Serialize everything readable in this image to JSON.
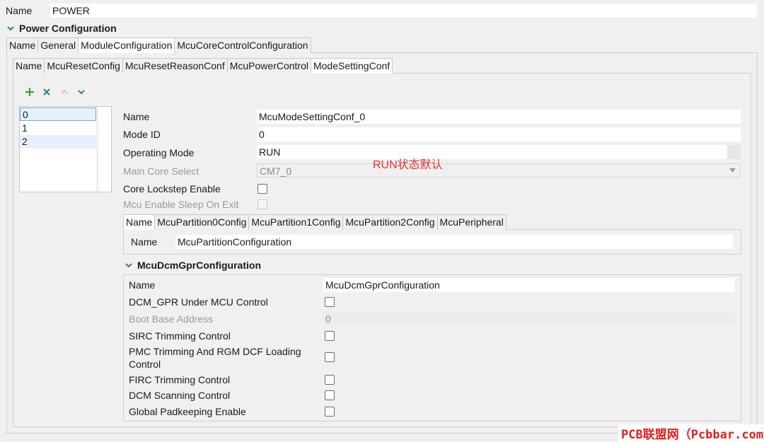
{
  "top": {
    "name_label": "Name",
    "name_value": "POWER"
  },
  "power_section": {
    "title": "Power Configuration"
  },
  "outer_tabs": [
    "Name",
    "General",
    "ModuleConfiguration",
    "McuCoreControlConfiguration"
  ],
  "inner_tabs": [
    "Name",
    "McuResetConfig",
    "McuResetReasonConf",
    "McuPowerControl",
    "ModeSettingConf"
  ],
  "list": {
    "items": [
      "0",
      "1",
      "2"
    ]
  },
  "form": {
    "name_label": "Name",
    "name_value": "McuModeSettingConf_0",
    "modeid_label": "Mode ID",
    "modeid_value": "0",
    "opmode_label": "Operating Mode",
    "opmode_value": "RUN",
    "maincore_label": "Main Core Select",
    "maincore_value": "CM7_0",
    "lockstep_label": "Core Lockstep Enable",
    "sleep_label": "Mcu Enable Sleep On Exit"
  },
  "partition_tabs": [
    "Name",
    "McuPartition0Config",
    "McuPartition1Config",
    "McuPartition2Config",
    "McuPeripheral"
  ],
  "partition": {
    "name_label": "Name",
    "name_value": "McuPartitionConfiguration"
  },
  "dcm": {
    "title": "McuDcmGprConfiguration",
    "name_label": "Name",
    "name_value": "McuDcmGprConfiguration",
    "dcm_gpr_label": "DCM_GPR Under MCU Control",
    "boot_label": "Boot Base Address",
    "boot_value": "0",
    "sirc_label": "SIRC Trimming Control",
    "pmc_label_1": "PMC Trimming And RGM DCF Loading",
    "pmc_label_2": "Control",
    "firc_label": "FIRC Trimming Control",
    "scan_label": "DCM Scanning Control",
    "padkeep_label": "Global Padkeeping Enable"
  },
  "annotation": "RUN状态默认",
  "watermark": "PCB联盟网（Pcbbar.com）",
  "colors": {
    "accent_chevron": "#2f7f7f",
    "add_icon": "#2e9a3e",
    "annotation": "#e5322d"
  }
}
